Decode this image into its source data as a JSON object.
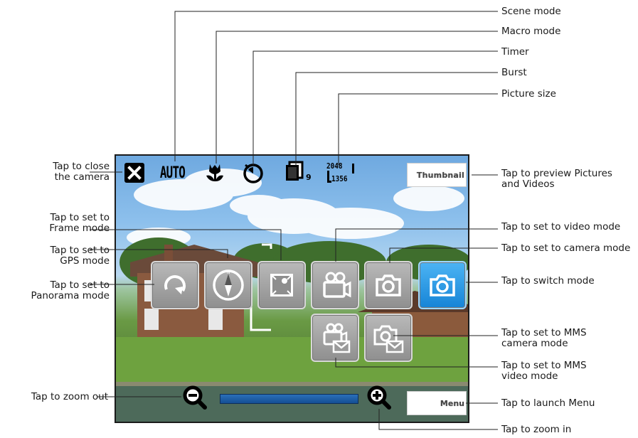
{
  "camera": {
    "thumbnail_label": "Thumbnail",
    "menu_label": "Menu",
    "scene_mode_value": "AUTO",
    "burst_count": "9",
    "picture_size_top": "2048",
    "picture_size_bottom": "1356",
    "zoom_level": 0.0
  },
  "callouts": {
    "scene_mode": "Scene mode",
    "macro_mode": "Macro mode",
    "timer": "Timer",
    "burst": "Burst",
    "picture_size": "Picture size",
    "close_camera_1": "Tap to close",
    "close_camera_2": "the camera",
    "frame_mode_1": "Tap to set to",
    "frame_mode_2": "Frame mode",
    "gps_mode_1": "Tap to set to",
    "gps_mode_2": "GPS mode",
    "panorama_mode_1": "Tap to set to",
    "panorama_mode_2": "Panorama mode",
    "zoom_out": "Tap to zoom out",
    "preview_1": "Tap to preview Pictures",
    "preview_2": "and Videos",
    "video_mode": "Tap to set to video mode",
    "camera_mode": "Tap to set to camera mode",
    "switch_mode": "Tap to switch mode",
    "mms_camera_1": "Tap to set to MMS",
    "mms_camera_2": "camera mode",
    "mms_video_1": "Tap to set to MMS",
    "mms_video_2": "video mode",
    "launch_menu": "Tap to launch Menu",
    "zoom_in": "Tap to zoom in"
  },
  "colors": {
    "active_mode": "#1684d6",
    "mode_button": "#a4a4a4",
    "zoom_bar": "#1f5fa8"
  },
  "icons": [
    "close-icon",
    "scene-auto-icon",
    "macro-flower-icon",
    "timer-icon",
    "burst-icon",
    "picture-size-icon",
    "panorama-icon",
    "gps-compass-icon",
    "frame-icon",
    "video-camera-icon",
    "camera-icon",
    "mms-video-icon",
    "mms-camera-icon",
    "zoom-out-icon",
    "zoom-in-icon"
  ]
}
